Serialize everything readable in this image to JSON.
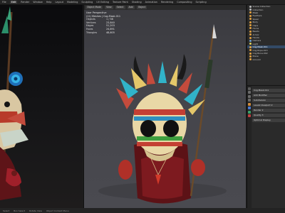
{
  "menubar": {
    "items": [
      "File",
      "Edit",
      "Render",
      "Window",
      "Help",
      "Layout",
      "Modeling",
      "Sculpting",
      "UV Editing",
      "Texture Paint",
      "Shading",
      "Animation",
      "Rendering",
      "Compositing",
      "Scripting"
    ],
    "active_index": 1
  },
  "viewport": {
    "mode_label": "Object Mode",
    "view_label": "View",
    "select_label": "Select",
    "add_label": "Add",
    "object_label": "Object",
    "title": "User Perspective",
    "subtitle": "(11) Meshes | Cog.Mask.011"
  },
  "stats": [
    {
      "k": "Objects",
      "v": "1 / 58"
    },
    {
      "k": "Vertices",
      "v": "23,840"
    },
    {
      "k": "Edges",
      "v": "51,203"
    },
    {
      "k": "Faces",
      "v": "24,891"
    },
    {
      "k": "Triangles",
      "v": "48,605"
    }
  ],
  "outliner": {
    "items": [
      {
        "label": "Scene Collection",
        "color": "#bbbbbb"
      },
      {
        "label": "Collection",
        "color": "#bbbbbb"
      },
      {
        "label": "Mask",
        "color": "#e0a040"
      },
      {
        "label": "Feathers",
        "color": "#e0a040"
      },
      {
        "label": "Spear",
        "color": "#e0a040"
      },
      {
        "label": "Body",
        "color": "#e0a040"
      },
      {
        "label": "Cape",
        "color": "#e0a040"
      },
      {
        "label": "Horns",
        "color": "#e0a040"
      },
      {
        "label": "Beads",
        "color": "#e0a040"
      },
      {
        "label": "Armor",
        "color": "#e0a040"
      },
      {
        "label": "Hands",
        "color": "#e0a040"
      },
      {
        "label": "Camera",
        "color": "#6fa0d0"
      },
      {
        "label": "Light",
        "color": "#d8d060"
      },
      {
        "label": "Cog.Mask.011",
        "color": "#e0a040"
      },
      {
        "label": "Cog.Rope.013",
        "color": "#e0a040"
      },
      {
        "label": "Cog.Bone.002",
        "color": "#e0a040"
      },
      {
        "label": "Plane",
        "color": "#e0a040"
      },
      {
        "label": "Ground",
        "color": "#e0a040"
      }
    ],
    "selected_index": 13
  },
  "properties": {
    "object_name": "Cog.Mask.011",
    "fields": [
      "Cog.Mask.011",
      "Add Modifier",
      "Subdivision",
      "Levels Viewport 2",
      "Render 2",
      "Quality 3",
      "Optimal Display"
    ]
  },
  "statusbar": {
    "items": [
      "Select",
      "Box Select",
      "Rotate View",
      "Object Context Menu"
    ]
  },
  "colors": {
    "accent": "#334a66",
    "viewport_bg": "#45454b",
    "panel_bg": "#2a2a2a"
  }
}
